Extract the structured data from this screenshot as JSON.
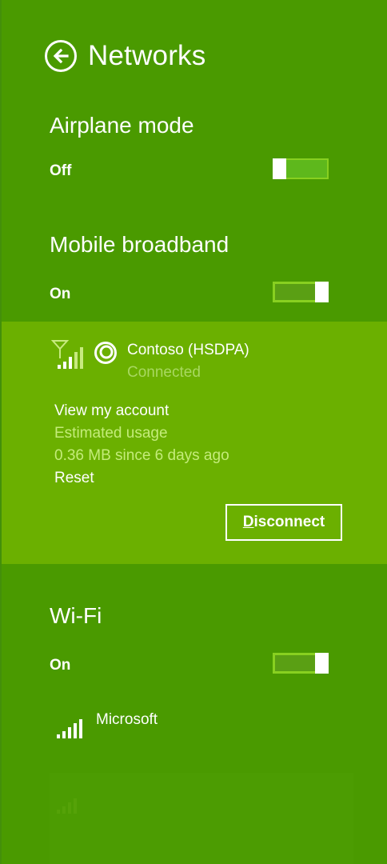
{
  "header": {
    "title": "Networks",
    "back_icon": "back-arrow-icon"
  },
  "airplane": {
    "title": "Airplane mode",
    "state_label": "Off",
    "on": false
  },
  "mobile": {
    "title": "Mobile broadband",
    "state_label": "On",
    "on": true,
    "connection": {
      "name": "Contoso (HSDPA)",
      "status": "Connected",
      "signal_icon": "cellular-signal-icon",
      "logo_icon": "carrier-logo-icon",
      "links": {
        "account": "View my account",
        "usage_title": "Estimated usage",
        "usage_value": "0.36 MB since 6 days ago",
        "reset": "Reset"
      },
      "disconnect_label_first": "D",
      "disconnect_label_rest": "isconnect"
    }
  },
  "wifi": {
    "title": "Wi-Fi",
    "state_label": "On",
    "on": true,
    "networks": [
      {
        "name": "Microsoft",
        "signal_icon": "wifi-signal-icon"
      }
    ]
  },
  "colors": {
    "background": "#4a9a00",
    "panel": "#6bb000",
    "accent": "#88d020"
  }
}
